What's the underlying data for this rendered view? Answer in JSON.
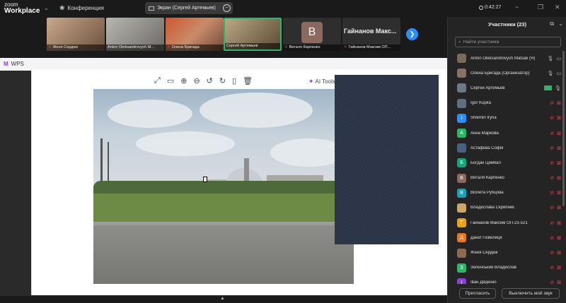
{
  "app": {
    "logo_line1": "zoom",
    "logo_line2": "Workplace",
    "conference_label": "Конференция",
    "share_label": "Экран (Сергей Артемьев)",
    "clock": "0:42:27"
  },
  "strip": {
    "thumbs": [
      {
        "name": "Женя Сердюк"
      },
      {
        "name": "Anton Oleksandrovych M..."
      },
      {
        "name": "Олена Бригада"
      },
      {
        "name": "Сергей Артемьев"
      },
      {
        "initial": "В",
        "name": "Виталя Карпенко"
      },
      {
        "bigname": "Гайнанов Макс...",
        "name": "Гайнанов Максим ОП..."
      }
    ]
  },
  "stage": {
    "wps_label": "WPS",
    "ai_tools": "AI Tools"
  },
  "panel": {
    "title": "Участники (23)",
    "search_placeholder": "Найти участника",
    "participants": [
      {
        "name": "Anton Oleksandrovych Matsak (Я)",
        "initial": "",
        "color": "#7a6a5c"
      },
      {
        "name": "Олена Бригада (Организатор)",
        "initial": "",
        "color": "#8a7060"
      },
      {
        "name": "Сергей Артемьев",
        "initial": "",
        "color": "#6c7a88"
      },
      {
        "name": "Igor Kupka",
        "initial": "",
        "color": "#5f6f7f"
      },
      {
        "name": "Shlemin Iryna",
        "initial": "I",
        "color": "#2d8cff"
      },
      {
        "name": "Анна Маркова",
        "initial": "А",
        "color": "#2fb56a"
      },
      {
        "name": "Астафєва Софія",
        "initial": "",
        "color": "#4a5f80"
      },
      {
        "name": "Богдан Цимбал",
        "initial": "Б",
        "color": "#1aa37a"
      },
      {
        "name": "Виталя Карпенко",
        "initial": "В",
        "color": "#8a6a5e"
      },
      {
        "name": "Віолета Рубцова",
        "initial": "В",
        "color": "#17a2b8"
      },
      {
        "name": "Владислава Скрипник",
        "initial": "",
        "color": "#c9a870"
      },
      {
        "name": "Гайнанов Максим ОП-23-521",
        "initial": "Г",
        "color": "#e6a21a"
      },
      {
        "name": "Даніл Повелиця",
        "initial": "Д",
        "color": "#e07a2a"
      },
      {
        "name": "Женя Сердюк",
        "initial": "",
        "color": "#8a6a50"
      },
      {
        "name": "Зеленський Владислав",
        "initial": "З",
        "color": "#2fb56a"
      },
      {
        "name": "Іван Дяденко",
        "initial": "І",
        "color": "#8b3fd9"
      }
    ],
    "invite_label": "Пригласить",
    "mute_label": "Выключить мой звук"
  },
  "colors": {
    "accent": "#2d8cff",
    "active_border": "#2fb56a",
    "muted_red": "#e0444a"
  }
}
